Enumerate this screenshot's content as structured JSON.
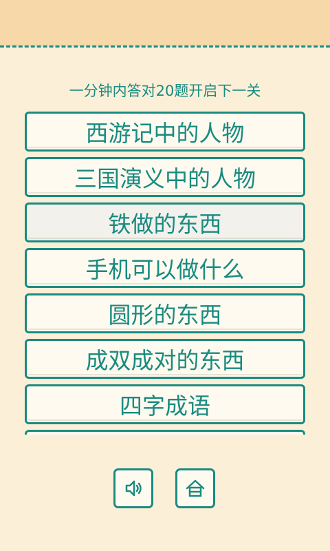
{
  "header": {
    "subtitle": "一分钟内答对20题开启下一关"
  },
  "categories": [
    {
      "label": "西游记中的人物",
      "selected": false
    },
    {
      "label": "三国演义中的人物",
      "selected": false
    },
    {
      "label": "铁做的东西",
      "selected": true
    },
    {
      "label": "手机可以做什么",
      "selected": false
    },
    {
      "label": "圆形的东西",
      "selected": false
    },
    {
      "label": "成双成对的东西",
      "selected": false
    },
    {
      "label": "四字成语",
      "selected": false
    }
  ],
  "toolbar": {
    "sound_icon": "speaker-icon",
    "home_icon": "home-icon"
  },
  "colors": {
    "accent": "#198b80",
    "background": "#fcefd8",
    "top_band": "#f7d8a8",
    "button_fill": "#fffaf0",
    "button_selected_fill": "#f2f1ec"
  }
}
